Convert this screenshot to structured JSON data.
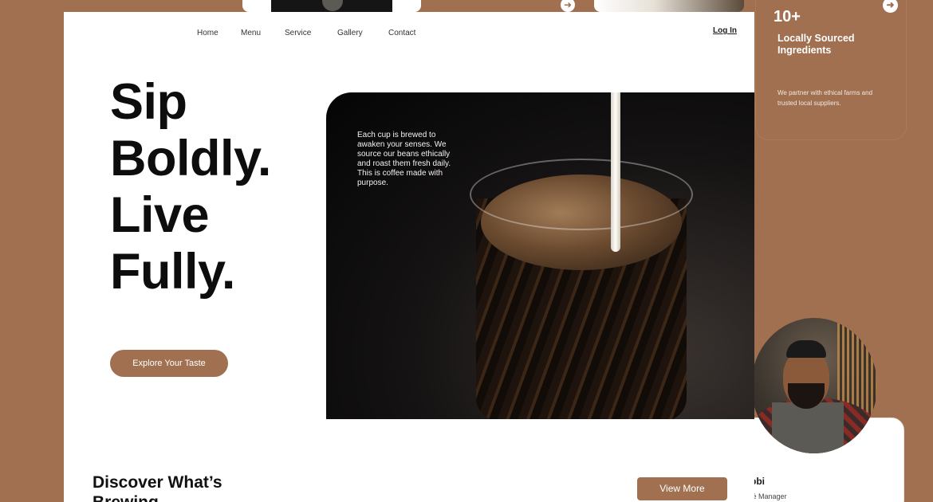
{
  "nav": {
    "items": [
      "Home",
      "Menu",
      "Service",
      "Gallery",
      "Contact"
    ],
    "login": "Log In"
  },
  "hero": {
    "headline": [
      "Sip",
      "Boldly.",
      "Live",
      "Fully."
    ],
    "cta": "Explore Your Taste",
    "image_text": "Each cup is brewed to awaken your senses. We source our beans ethically and roast them fresh daily. This is coffee made with purpose."
  },
  "info_card": {
    "stat": "10+",
    "title": "Locally Sourced Ingredients",
    "description": "We partner with ethical farms and trusted local suppliers."
  },
  "profile_card": {
    "name": "bbi",
    "role": "fé Manager"
  },
  "discover": {
    "title": "Discover What’s Brewing",
    "view_more": "View More"
  },
  "colors": {
    "accent": "#a07050",
    "background": "#a07050",
    "text": "#0d0d0d"
  }
}
